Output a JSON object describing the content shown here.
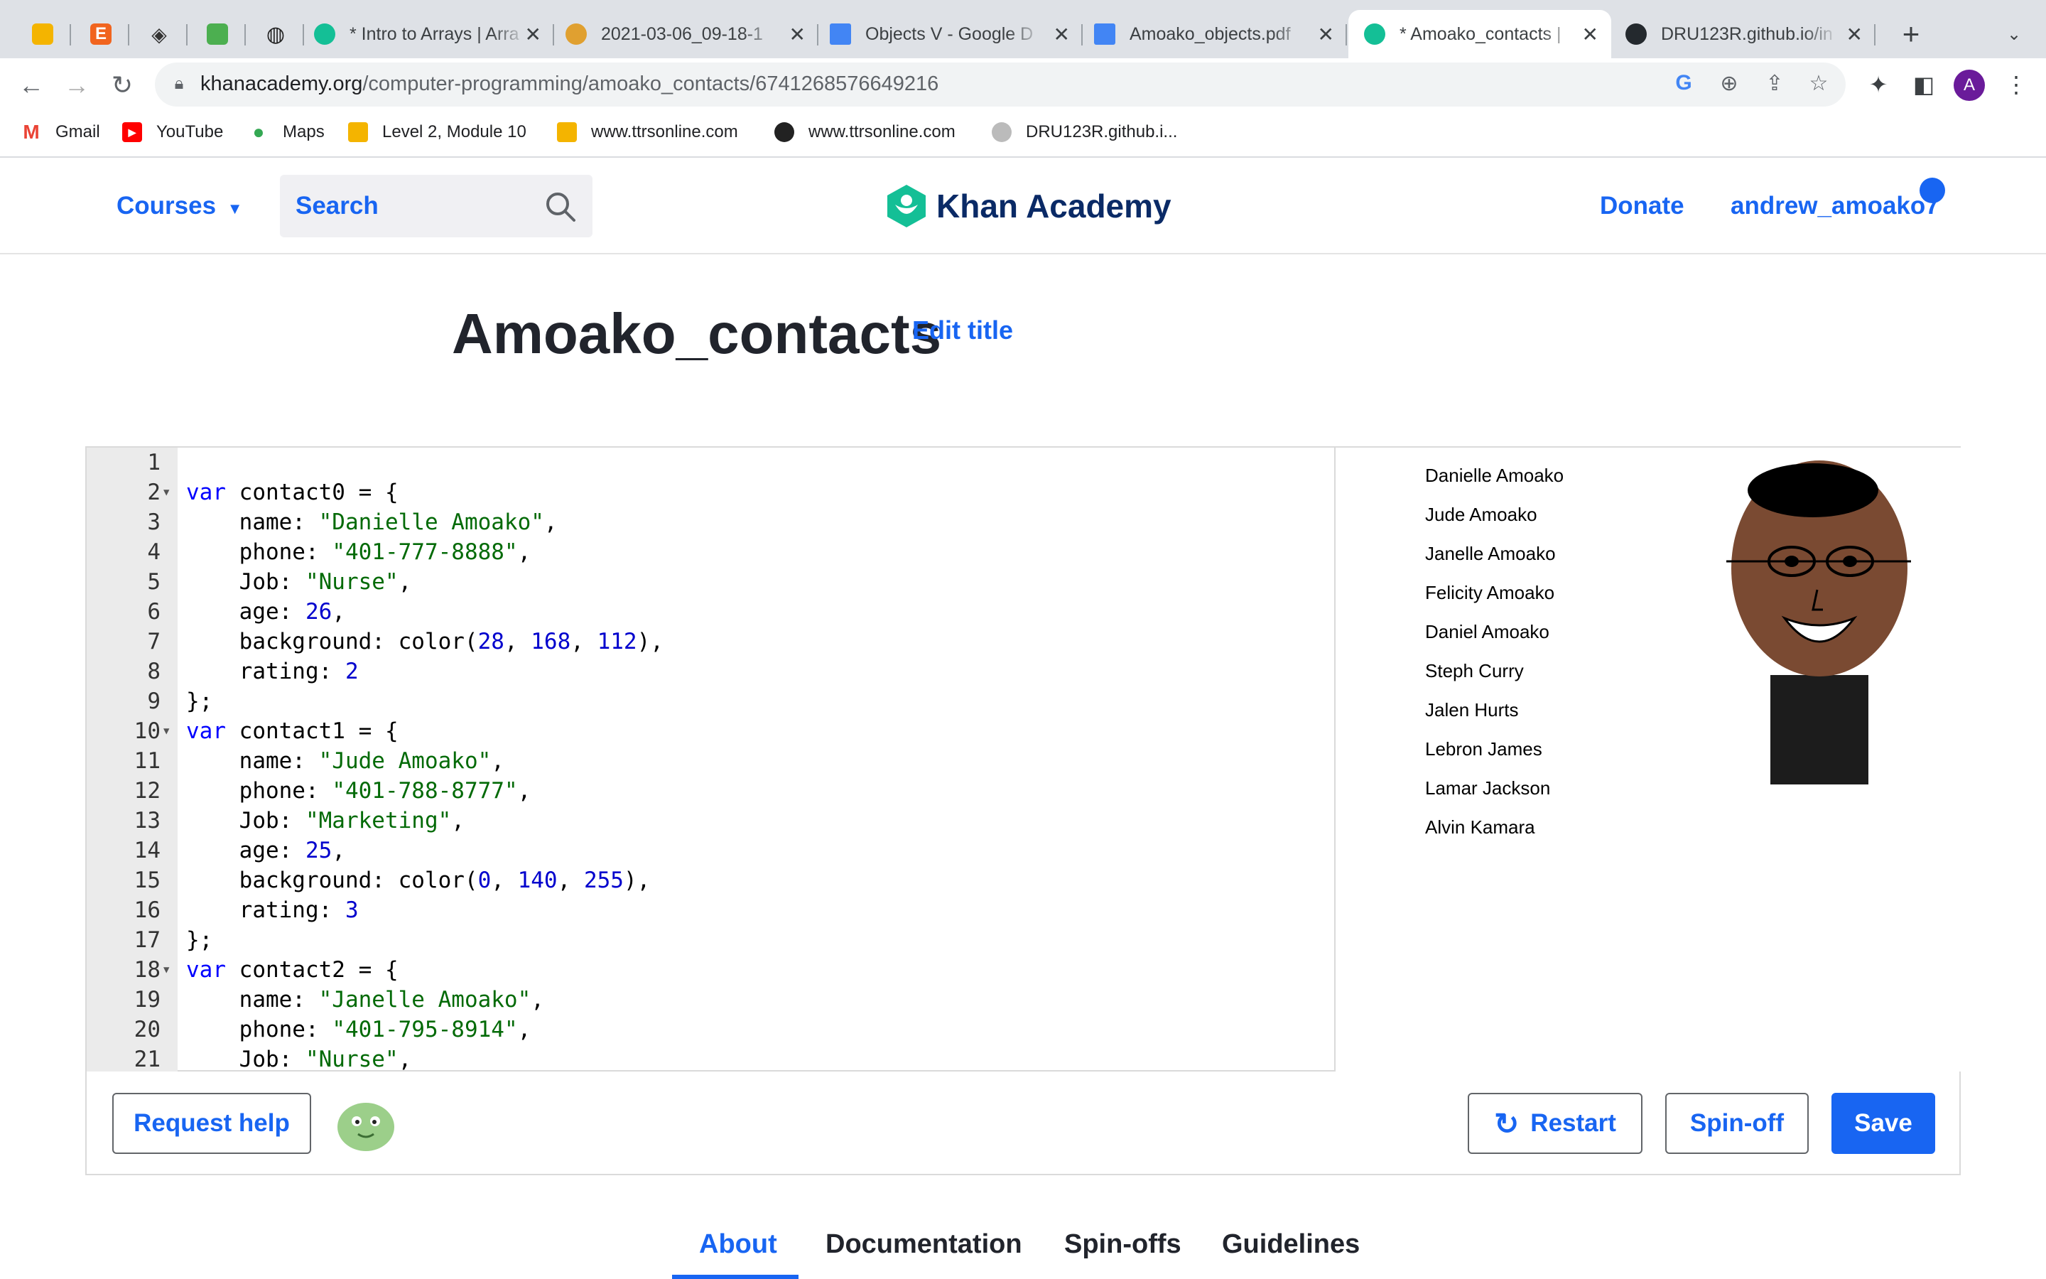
{
  "browser": {
    "tabs": [
      {
        "title": "",
        "icon": "slides-icon"
      },
      {
        "title": "",
        "icon": "etsy-icon"
      },
      {
        "title": "",
        "icon": "diamond-icon"
      },
      {
        "title": "",
        "icon": "scratch-icon"
      },
      {
        "title": "",
        "icon": "globe-icon"
      },
      {
        "title": "* Intro to Arrays | Arra",
        "icon": "khan-icon"
      },
      {
        "title": "2021-03-06_09-18-1",
        "icon": "uri-icon"
      },
      {
        "title": "Objects V - Google D",
        "icon": "docs-icon"
      },
      {
        "title": "Amoako_objects.pdf",
        "icon": "docs-icon"
      },
      {
        "title": "* Amoako_contacts |",
        "icon": "khan-icon"
      },
      {
        "title": "DRU123R.github.io/in",
        "icon": "github-icon"
      }
    ],
    "new_tab": "+",
    "url_domain": "khanacademy.org",
    "url_path": "/computer-programming/amoako_contacts/6741268576649216",
    "profile_initial": "A",
    "bookmarks": [
      {
        "label": "Gmail"
      },
      {
        "label": "YouTube"
      },
      {
        "label": "Maps"
      },
      {
        "label": "Level 2, Module 10"
      },
      {
        "label": "www.ttrsonline.com"
      },
      {
        "label": "www.ttrsonline.com"
      },
      {
        "label": "DRU123R.github.i..."
      }
    ]
  },
  "header": {
    "courses": "Courses",
    "search_placeholder": "Search",
    "brand": "Khan Academy",
    "donate": "Donate",
    "username": "andrew_amoako7"
  },
  "page": {
    "title": "Amoako_contacts",
    "edit_title": "Edit title"
  },
  "editor": {
    "lines": [
      {
        "n": "1",
        "fold": false,
        "parts": []
      },
      {
        "n": "2",
        "fold": true,
        "parts": [
          [
            "kw",
            "var"
          ],
          [
            "p",
            " contact0 = {"
          ]
        ]
      },
      {
        "n": "3",
        "fold": false,
        "parts": [
          [
            "p",
            "    name: "
          ],
          [
            "st",
            "\"Danielle Amoako\""
          ],
          [
            "p",
            ","
          ]
        ]
      },
      {
        "n": "4",
        "fold": false,
        "parts": [
          [
            "p",
            "    phone: "
          ],
          [
            "st",
            "\"401-777-8888\""
          ],
          [
            "p",
            ","
          ]
        ]
      },
      {
        "n": "5",
        "fold": false,
        "parts": [
          [
            "p",
            "    Job: "
          ],
          [
            "st",
            "\"Nurse\""
          ],
          [
            "p",
            ","
          ]
        ]
      },
      {
        "n": "6",
        "fold": false,
        "parts": [
          [
            "p",
            "    age: "
          ],
          [
            "nm",
            "26"
          ],
          [
            "p",
            ","
          ]
        ]
      },
      {
        "n": "7",
        "fold": false,
        "parts": [
          [
            "p",
            "    background: color("
          ],
          [
            "nm",
            "28"
          ],
          [
            "p",
            ", "
          ],
          [
            "nm",
            "168"
          ],
          [
            "p",
            ", "
          ],
          [
            "nm",
            "112"
          ],
          [
            "p",
            "),"
          ]
        ]
      },
      {
        "n": "8",
        "fold": false,
        "parts": [
          [
            "p",
            "    rating: "
          ],
          [
            "nm",
            "2"
          ]
        ]
      },
      {
        "n": "9",
        "fold": false,
        "parts": [
          [
            "p",
            "};"
          ]
        ]
      },
      {
        "n": "10",
        "fold": true,
        "parts": [
          [
            "kw",
            "var"
          ],
          [
            "p",
            " contact1 = {"
          ]
        ]
      },
      {
        "n": "11",
        "fold": false,
        "parts": [
          [
            "p",
            "    name: "
          ],
          [
            "st",
            "\"Jude Amoako\""
          ],
          [
            "p",
            ","
          ]
        ]
      },
      {
        "n": "12",
        "fold": false,
        "parts": [
          [
            "p",
            "    phone: "
          ],
          [
            "st",
            "\"401-788-8777\""
          ],
          [
            "p",
            ","
          ]
        ]
      },
      {
        "n": "13",
        "fold": false,
        "parts": [
          [
            "p",
            "    Job: "
          ],
          [
            "st",
            "\"Marketing\""
          ],
          [
            "p",
            ","
          ]
        ]
      },
      {
        "n": "14",
        "fold": false,
        "parts": [
          [
            "p",
            "    age: "
          ],
          [
            "nm",
            "25"
          ],
          [
            "p",
            ","
          ]
        ]
      },
      {
        "n": "15",
        "fold": false,
        "parts": [
          [
            "p",
            "    background: color("
          ],
          [
            "nm",
            "0"
          ],
          [
            "p",
            ", "
          ],
          [
            "nm",
            "140"
          ],
          [
            "p",
            ", "
          ],
          [
            "nm",
            "255"
          ],
          [
            "p",
            "),"
          ]
        ]
      },
      {
        "n": "16",
        "fold": false,
        "parts": [
          [
            "p",
            "    rating: "
          ],
          [
            "nm",
            "3"
          ]
        ]
      },
      {
        "n": "17",
        "fold": false,
        "parts": [
          [
            "p",
            "};"
          ]
        ]
      },
      {
        "n": "18",
        "fold": true,
        "parts": [
          [
            "kw",
            "var"
          ],
          [
            "p",
            " contact2 = {"
          ]
        ]
      },
      {
        "n": "19",
        "fold": false,
        "parts": [
          [
            "p",
            "    name: "
          ],
          [
            "st",
            "\"Janelle Amoako\""
          ],
          [
            "p",
            ","
          ]
        ]
      },
      {
        "n": "20",
        "fold": false,
        "parts": [
          [
            "p",
            "    phone: "
          ],
          [
            "st",
            "\"401-795-8914\""
          ],
          [
            "p",
            ","
          ]
        ]
      },
      {
        "n": "21",
        "fold": false,
        "parts": [
          [
            "p",
            "    Job: "
          ],
          [
            "st",
            "\"Nurse\""
          ],
          [
            "p",
            ","
          ]
        ]
      }
    ]
  },
  "canvas": {
    "names": [
      "Danielle Amoako",
      "Jude Amoako",
      "Janelle Amoako",
      "Felicity Amoako",
      "Daniel Amoako",
      "Steph Curry",
      "Jalen Hurts",
      "Lebron James",
      "Lamar Jackson",
      "Alvin Kamara"
    ]
  },
  "actions": {
    "request_help": "Request help",
    "restart": "Restart",
    "spin_off": "Spin-off",
    "save": "Save"
  },
  "bottom_tabs": [
    "About",
    "Documentation",
    "Spin-offs",
    "Guidelines"
  ],
  "colors": {
    "accent": "#1865f2",
    "brand_green": "#14bf96",
    "face": "#7a4a32"
  }
}
